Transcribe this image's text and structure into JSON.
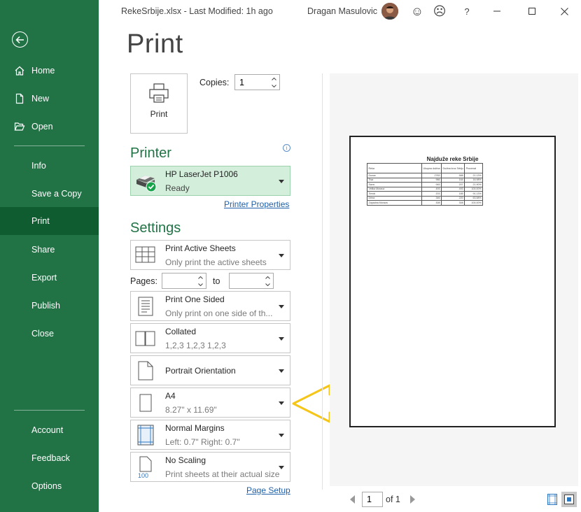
{
  "titlebar": {
    "doc_title": "RekeSrbije.xlsx  -  Last Modified: 1h ago",
    "user_name": "Dragan Masulovic",
    "smile_symbol": "☺",
    "frown_symbol": "☹",
    "help_symbol": "?"
  },
  "nav": {
    "items": [
      {
        "label": "Home",
        "icon": "home-icon"
      },
      {
        "label": "New",
        "icon": "new-document-icon"
      },
      {
        "label": "Open",
        "icon": "folder-open-icon"
      },
      {
        "label": "Info"
      },
      {
        "label": "Save a Copy"
      },
      {
        "label": "Print",
        "active": true
      },
      {
        "label": "Share"
      },
      {
        "label": "Export"
      },
      {
        "label": "Publish"
      },
      {
        "label": "Close"
      },
      {
        "label": "Account"
      },
      {
        "label": "Feedback"
      },
      {
        "label": "Options"
      }
    ]
  },
  "print": {
    "title": "Print",
    "button_label": "Print",
    "copies_label": "Copies:",
    "copies_value": "1"
  },
  "printer": {
    "heading": "Printer",
    "name": "HP LaserJet P1006",
    "status": "Ready",
    "properties_link": "Printer Properties"
  },
  "settings": {
    "heading": "Settings",
    "what": {
      "title": "Print Active Sheets",
      "sub": "Only print the active sheets"
    },
    "pages_label": "Pages:",
    "to_label": "to",
    "sides": {
      "title": "Print One Sided",
      "sub": "Only print on one side of th..."
    },
    "collate": {
      "title": "Collated",
      "sub": "1,2,3    1,2,3    1,2,3"
    },
    "orientation": {
      "title": "Portrait Orientation"
    },
    "paper": {
      "title": "A4",
      "sub": "8.27\" x 11.69\""
    },
    "margins": {
      "title": "Normal Margins",
      "sub": "Left:  0.7\"    Right:  0.7\""
    },
    "scaling": {
      "title": "No Scaling",
      "sub": "Print sheets at their actual size",
      "icon_text": "100"
    },
    "page_setup_link": "Page Setup"
  },
  "preview": {
    "sheet_title": "Najduže reke Srbije",
    "current_page": "1",
    "of_label": "of 1"
  },
  "colors": {
    "brand_green": "#217346",
    "nav_active": "#0e5c30",
    "annotation_arrow": "#f5c518"
  }
}
